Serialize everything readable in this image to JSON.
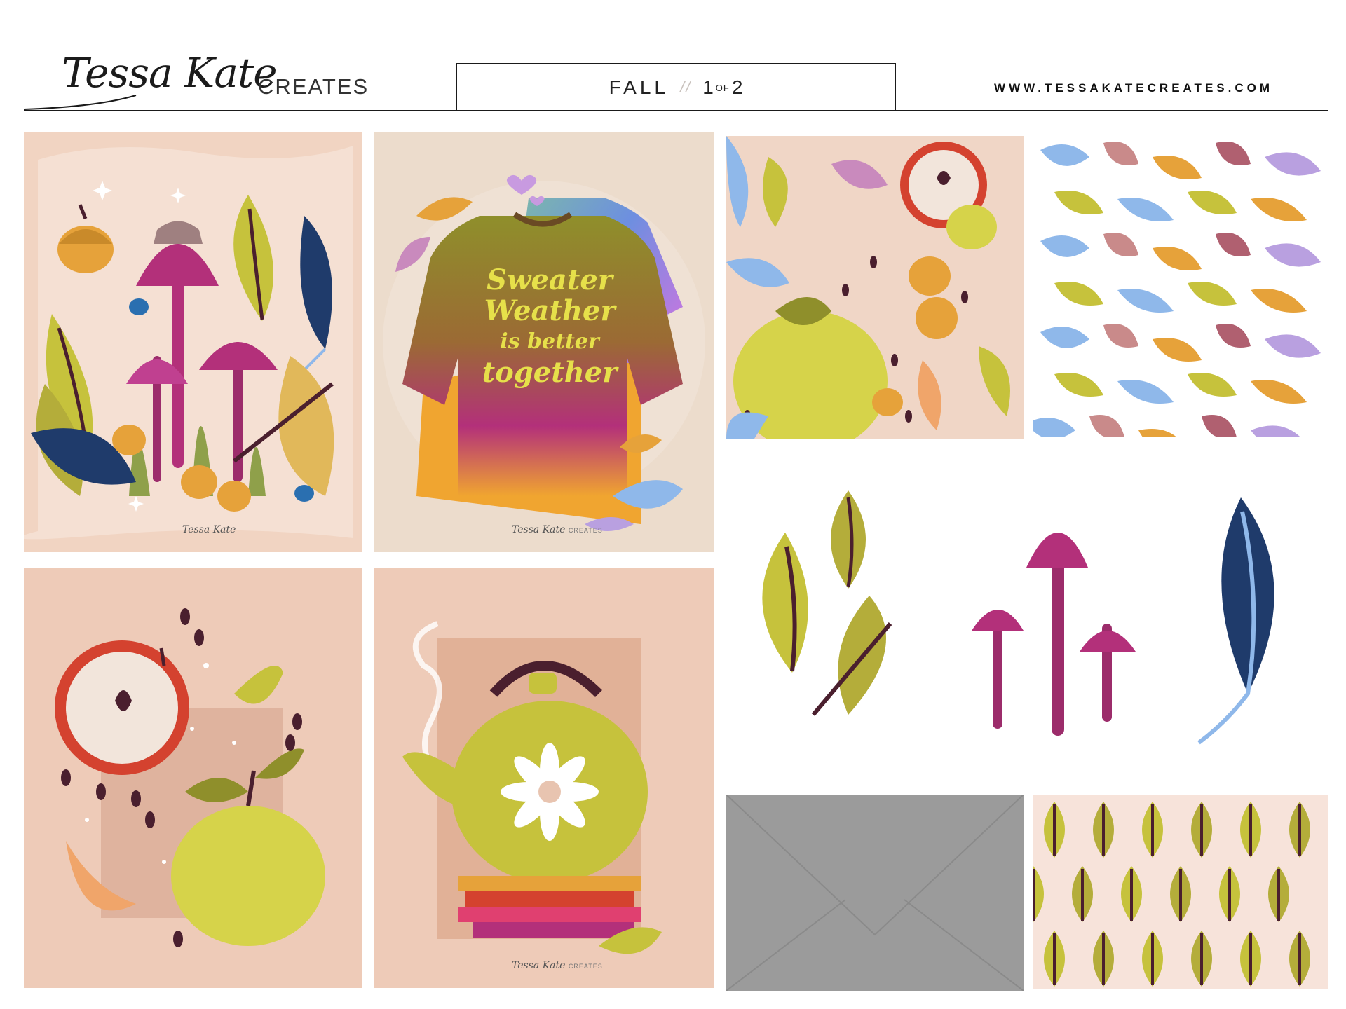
{
  "brand": {
    "script": "Tessa Kate",
    "suffix": "CREATES",
    "url": "WWW.TESSAKATECREATES.COM"
  },
  "page": {
    "season": "FALL",
    "separator": "//",
    "page_num": "1",
    "of": "OF",
    "total": "2"
  },
  "cards": {
    "sweater_text": [
      "Sweater",
      "Weather",
      "is better",
      "together"
    ],
    "signature": "Tessa Kate",
    "signature_suffix": "CREATES"
  },
  "colors": {
    "peach": "#f1d4c2",
    "blush": "#eecbb8",
    "mustard": "#c6c23c",
    "olive": "#8f8f2b",
    "magenta": "#b3307a",
    "navy": "#1f3b6b",
    "plum": "#4a1f2e",
    "orange": "#e6a23a",
    "gray": "#9b9b9b",
    "sky": "#8fb8ea"
  }
}
